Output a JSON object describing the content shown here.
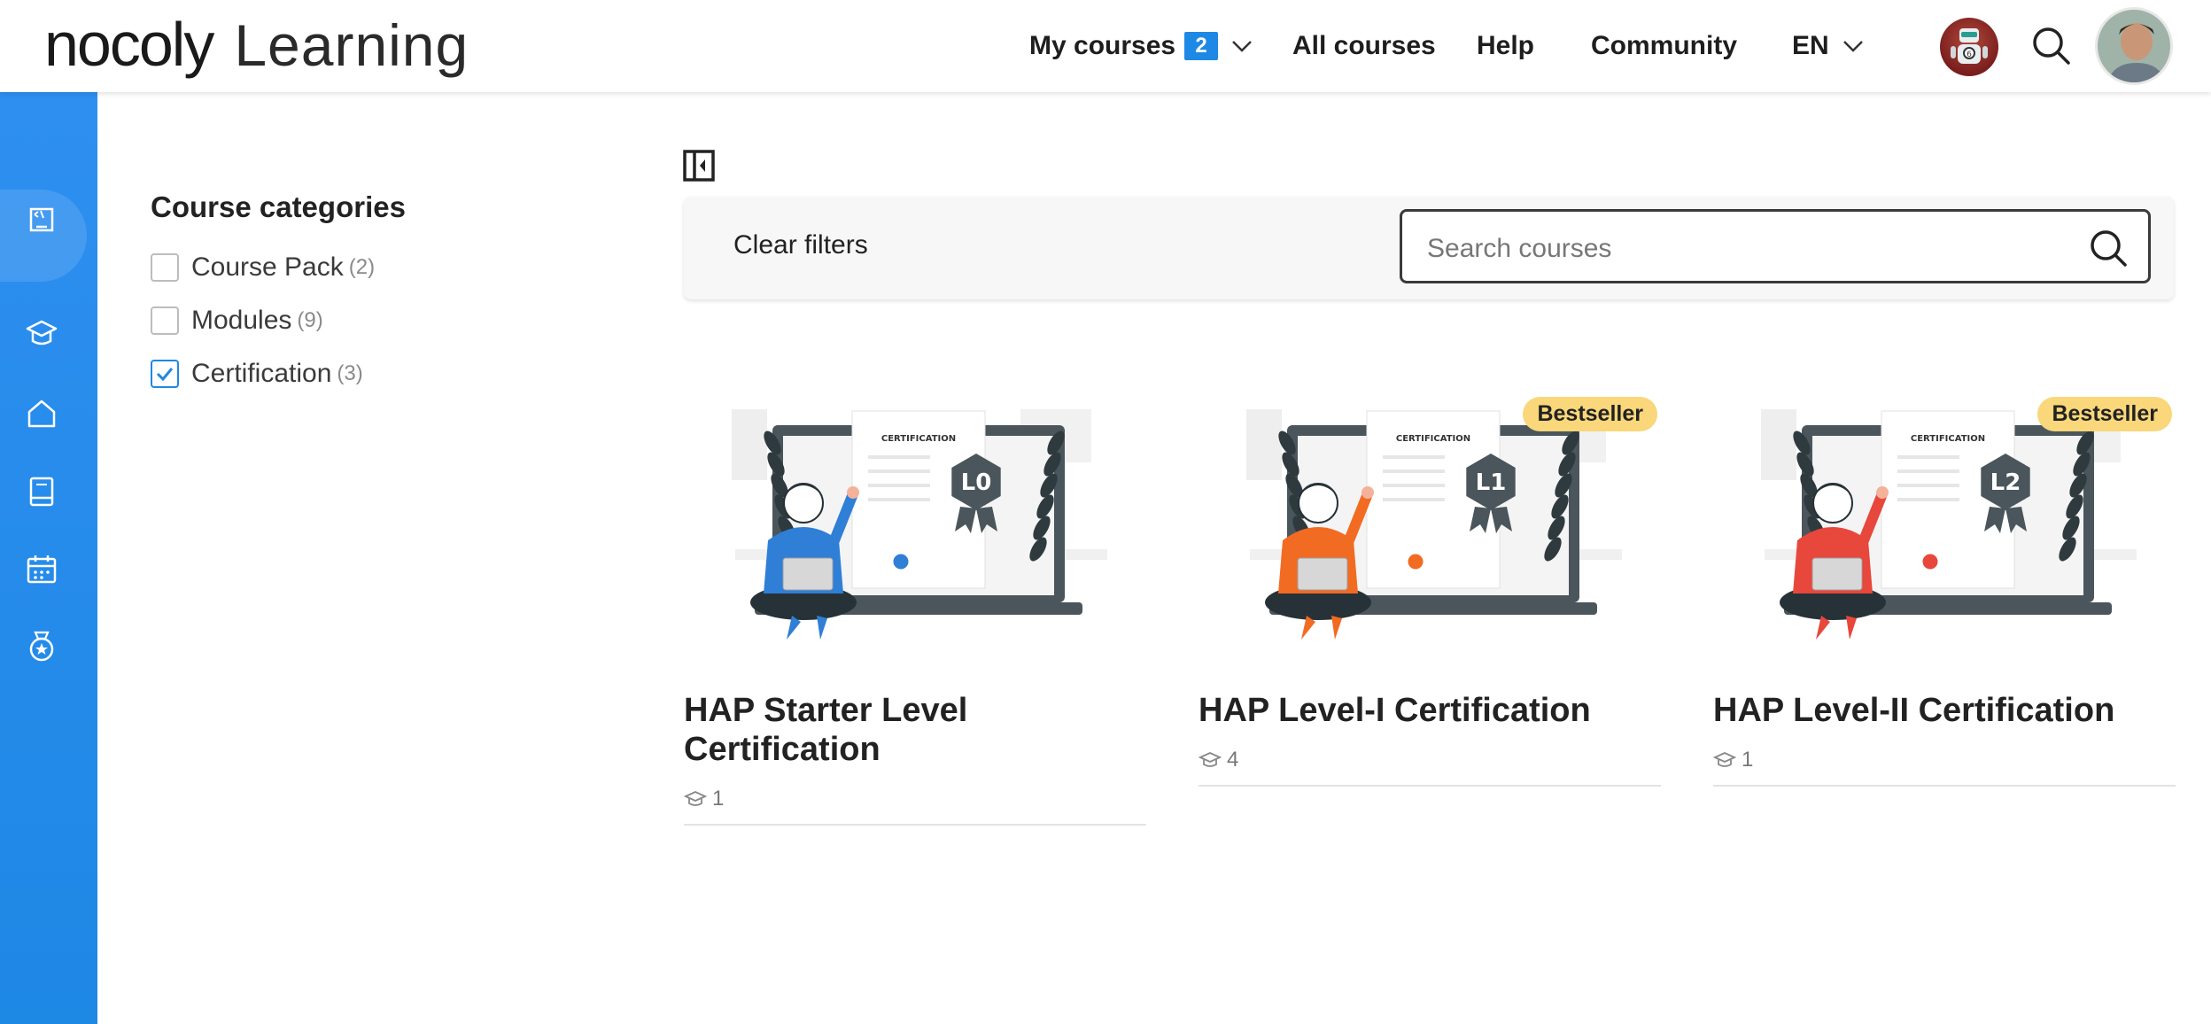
{
  "header": {
    "logo_brand": "nocoly",
    "logo_sub": "Learning",
    "nav": {
      "my_courses": "My courses",
      "my_courses_count": "2",
      "all_courses": "All courses",
      "help": "Help",
      "community": "Community",
      "language": "EN"
    }
  },
  "sidebar": {
    "items": [
      "dashboard-icon",
      "graduation-cap-icon",
      "home-icon",
      "book-icon",
      "calendar-icon",
      "badge-icon"
    ]
  },
  "filters": {
    "title": "Course categories",
    "items": [
      {
        "label": "Course Pack",
        "count": "(2)",
        "checked": false
      },
      {
        "label": "Modules",
        "count": "(9)",
        "checked": false
      },
      {
        "label": "Certification",
        "count": "(3)",
        "checked": true
      }
    ]
  },
  "toolbar": {
    "clear_filters": "Clear filters",
    "search_placeholder": "Search courses"
  },
  "courses": [
    {
      "title": "HAP Starter Level Certification",
      "students": "1",
      "badge": "",
      "level": "L0",
      "color": "#2f7fd6",
      "cert_label": "CERTIFICATION"
    },
    {
      "title": "HAP Level-I Certification",
      "students": "4",
      "badge": "Bestseller",
      "level": "L1",
      "color": "#f26b22",
      "cert_label": "CERTIFICATION"
    },
    {
      "title": "HAP Level-II Certification",
      "students": "1",
      "badge": "Bestseller",
      "level": "L2",
      "color": "#e8473b",
      "cert_label": "CERTIFICATION"
    }
  ],
  "colors": {
    "accent": "#1e88e5",
    "bestseller": "#f9d77a"
  }
}
